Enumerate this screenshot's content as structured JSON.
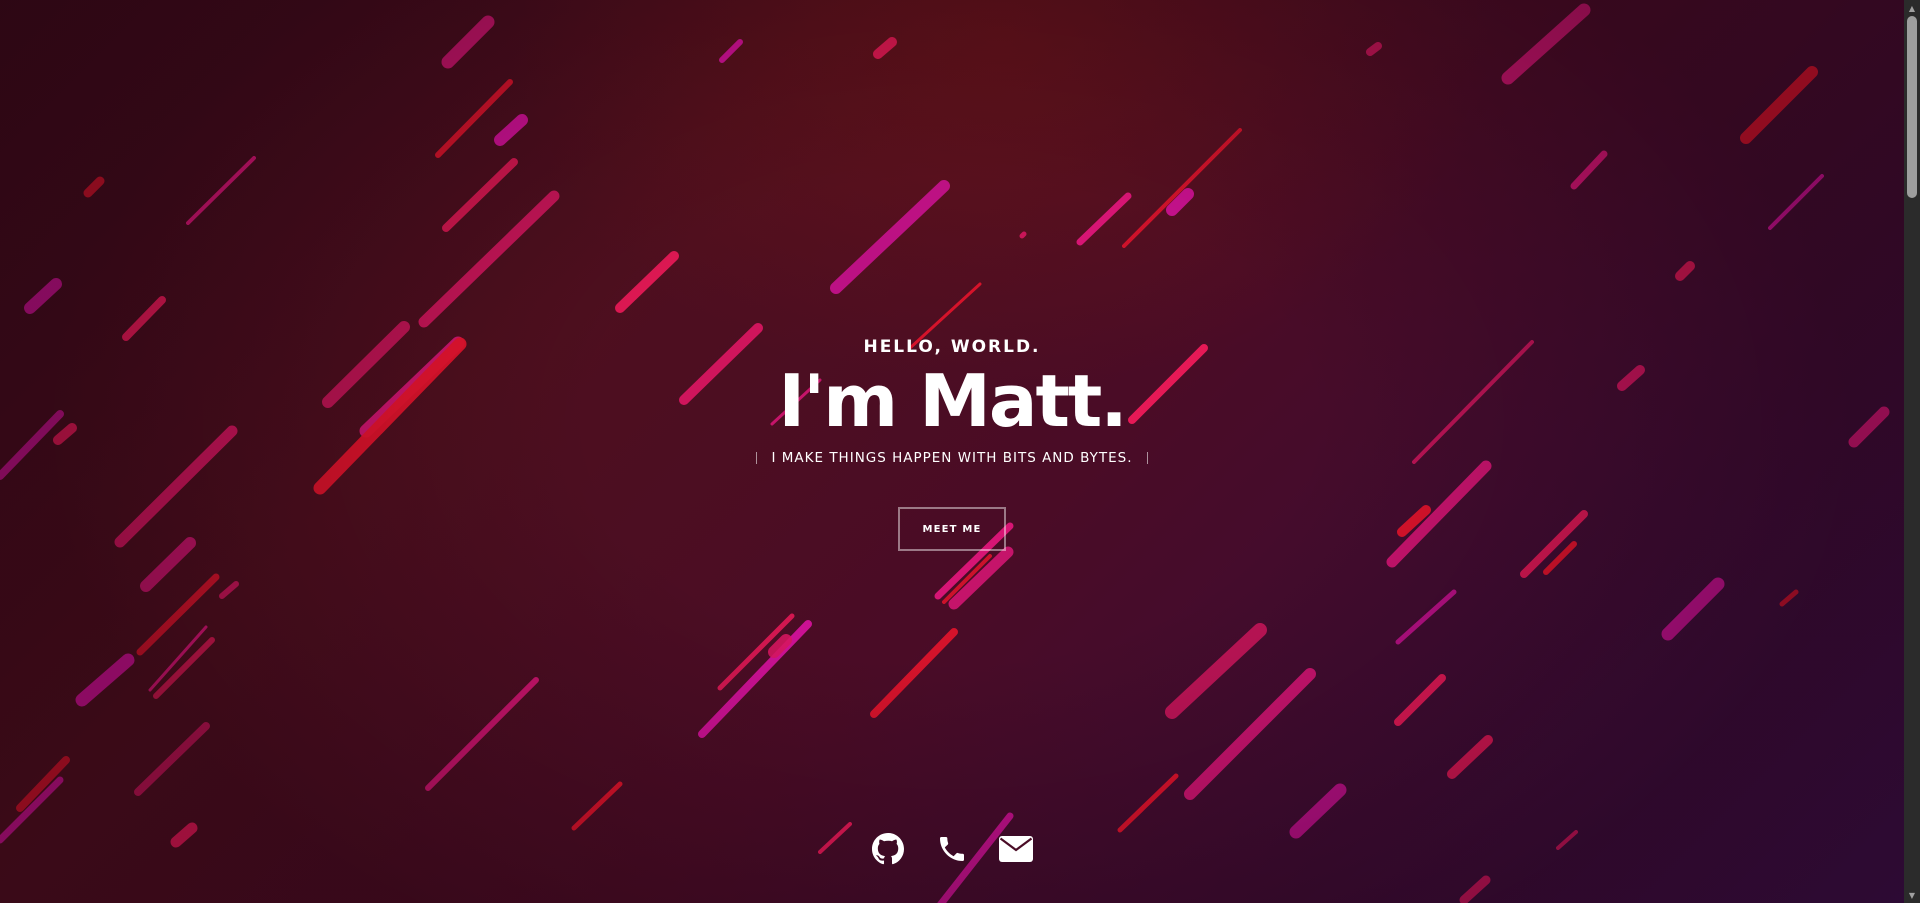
{
  "hero": {
    "greeting": "HELLO, WORLD.",
    "name": "I'm Matt.",
    "tagline": "I MAKE THINGS HAPPEN WITH BITS AND BYTES.",
    "cta_label": "MEET ME"
  },
  "socials": [
    {
      "name": "github",
      "icon": "github-icon"
    },
    {
      "name": "phone",
      "icon": "phone-icon"
    },
    {
      "name": "email",
      "icon": "envelope-icon"
    }
  ],
  "colors": {
    "background_dark": "#3b0a1a",
    "background_purple": "#3a0f4a",
    "streak_pink": "#e0167a",
    "streak_red": "#e8142c",
    "streak_magenta": "#d4129a",
    "text": "#ffffff"
  }
}
